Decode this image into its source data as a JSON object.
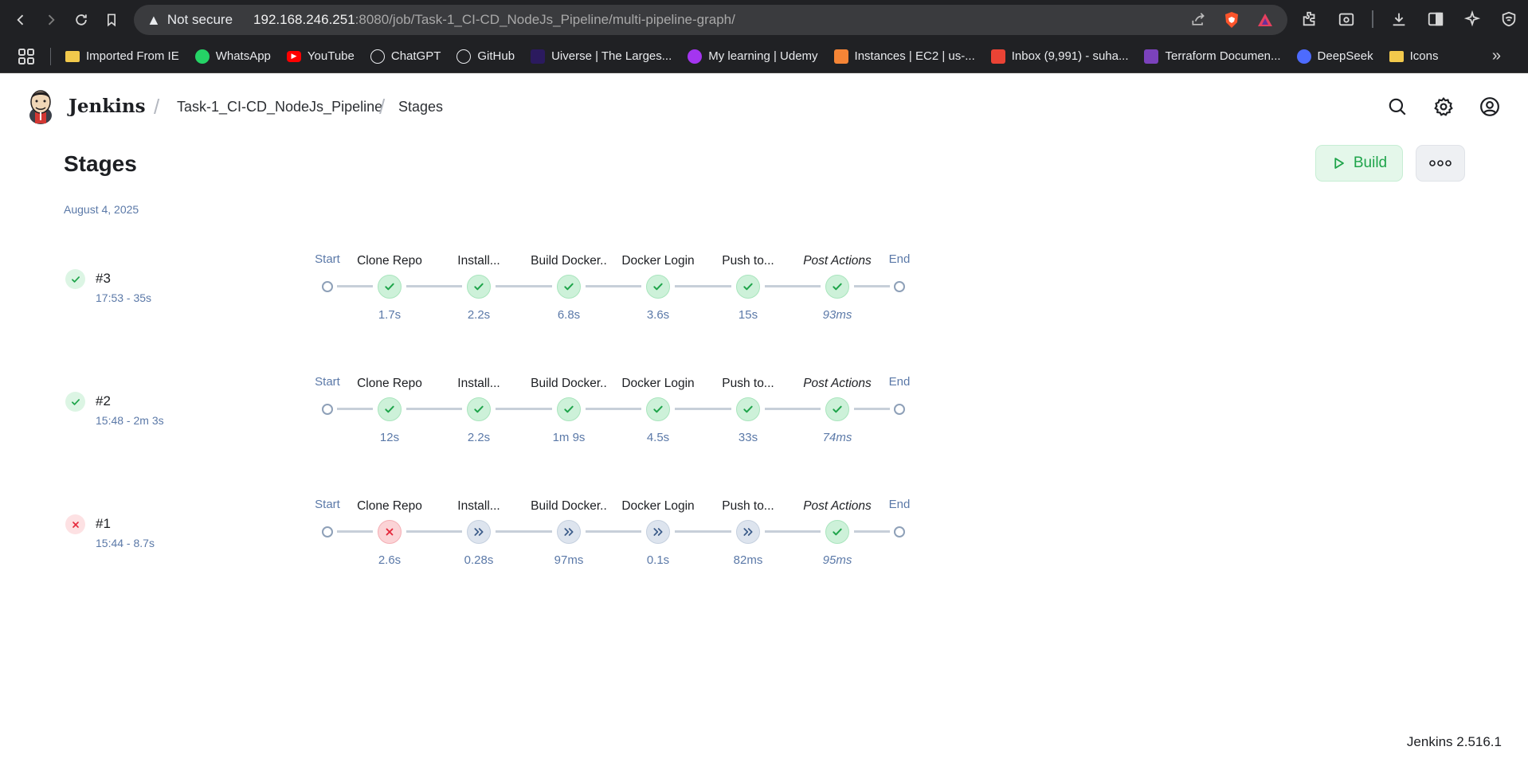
{
  "browser": {
    "security_label": "Not secure",
    "url_host": "192.168.246.251",
    "url_rest": ":8080/job/Task-1_CI-CD_NodeJs_Pipeline/multi-pipeline-graph/",
    "bookmarks": [
      {
        "label": "Imported From IE",
        "icon": "folder-icon",
        "color": "#f2c94c"
      },
      {
        "label": "WhatsApp",
        "icon": "whatsapp-icon",
        "color": "#25d366"
      },
      {
        "label": "YouTube",
        "icon": "youtube-icon",
        "color": "#ff0000"
      },
      {
        "label": "ChatGPT",
        "icon": "chatgpt-icon",
        "color": "#202124"
      },
      {
        "label": "GitHub",
        "icon": "github-icon",
        "color": "#202124"
      },
      {
        "label": "Uiverse | The Larges...",
        "icon": "uiverse-icon",
        "color": "#2b1a5e"
      },
      {
        "label": "My learning | Udemy",
        "icon": "udemy-icon",
        "color": "#a435f0"
      },
      {
        "label": "Instances | EC2 | us-...",
        "icon": "aws-ec2-icon",
        "color": "#f58536"
      },
      {
        "label": "Inbox (9,991) - suha...",
        "icon": "gmail-icon",
        "color": "#ea4335"
      },
      {
        "label": "Terraform Documen...",
        "icon": "terraform-icon",
        "color": "#7b42bc"
      },
      {
        "label": "DeepSeek",
        "icon": "deepseek-icon",
        "color": "#4d6bfe"
      },
      {
        "label": "Icons",
        "icon": "folder-icon",
        "color": "#f2c94c"
      }
    ]
  },
  "header": {
    "brand": "Jenkins",
    "breadcrumbs": [
      "Task-1_CI-CD_NodeJs_Pipeline",
      "Stages"
    ]
  },
  "page": {
    "title": "Stages",
    "build_label": "Build",
    "date": "August 4, 2025",
    "start_label": "Start",
    "end_label": "End",
    "stage_names": [
      "Clone Repo",
      "Install...",
      "Build Docker..",
      "Docker Login",
      "Push to...",
      "Post Actions"
    ],
    "runs": [
      {
        "number": "#3",
        "time": "17:53 - 35s",
        "status": "success",
        "stages": [
          {
            "status": "success",
            "duration": "1.7s"
          },
          {
            "status": "success",
            "duration": "2.2s"
          },
          {
            "status": "success",
            "duration": "6.8s"
          },
          {
            "status": "success",
            "duration": "3.6s"
          },
          {
            "status": "success",
            "duration": "15s"
          },
          {
            "status": "success",
            "duration": "93ms"
          }
        ]
      },
      {
        "number": "#2",
        "time": "15:48 - 2m 3s",
        "status": "success",
        "stages": [
          {
            "status": "success",
            "duration": "12s"
          },
          {
            "status": "success",
            "duration": "2.2s"
          },
          {
            "status": "success",
            "duration": "1m 9s"
          },
          {
            "status": "success",
            "duration": "4.5s"
          },
          {
            "status": "success",
            "duration": "33s"
          },
          {
            "status": "success",
            "duration": "74ms"
          }
        ]
      },
      {
        "number": "#1",
        "time": "15:44 - 8.7s",
        "status": "failed",
        "stages": [
          {
            "status": "failed",
            "duration": "2.6s"
          },
          {
            "status": "skipped",
            "duration": "0.28s"
          },
          {
            "status": "skipped",
            "duration": "97ms"
          },
          {
            "status": "skipped",
            "duration": "0.1s"
          },
          {
            "status": "skipped",
            "duration": "82ms"
          },
          {
            "status": "success",
            "duration": "95ms"
          }
        ]
      }
    ]
  },
  "footer": {
    "version": "Jenkins 2.516.1"
  }
}
